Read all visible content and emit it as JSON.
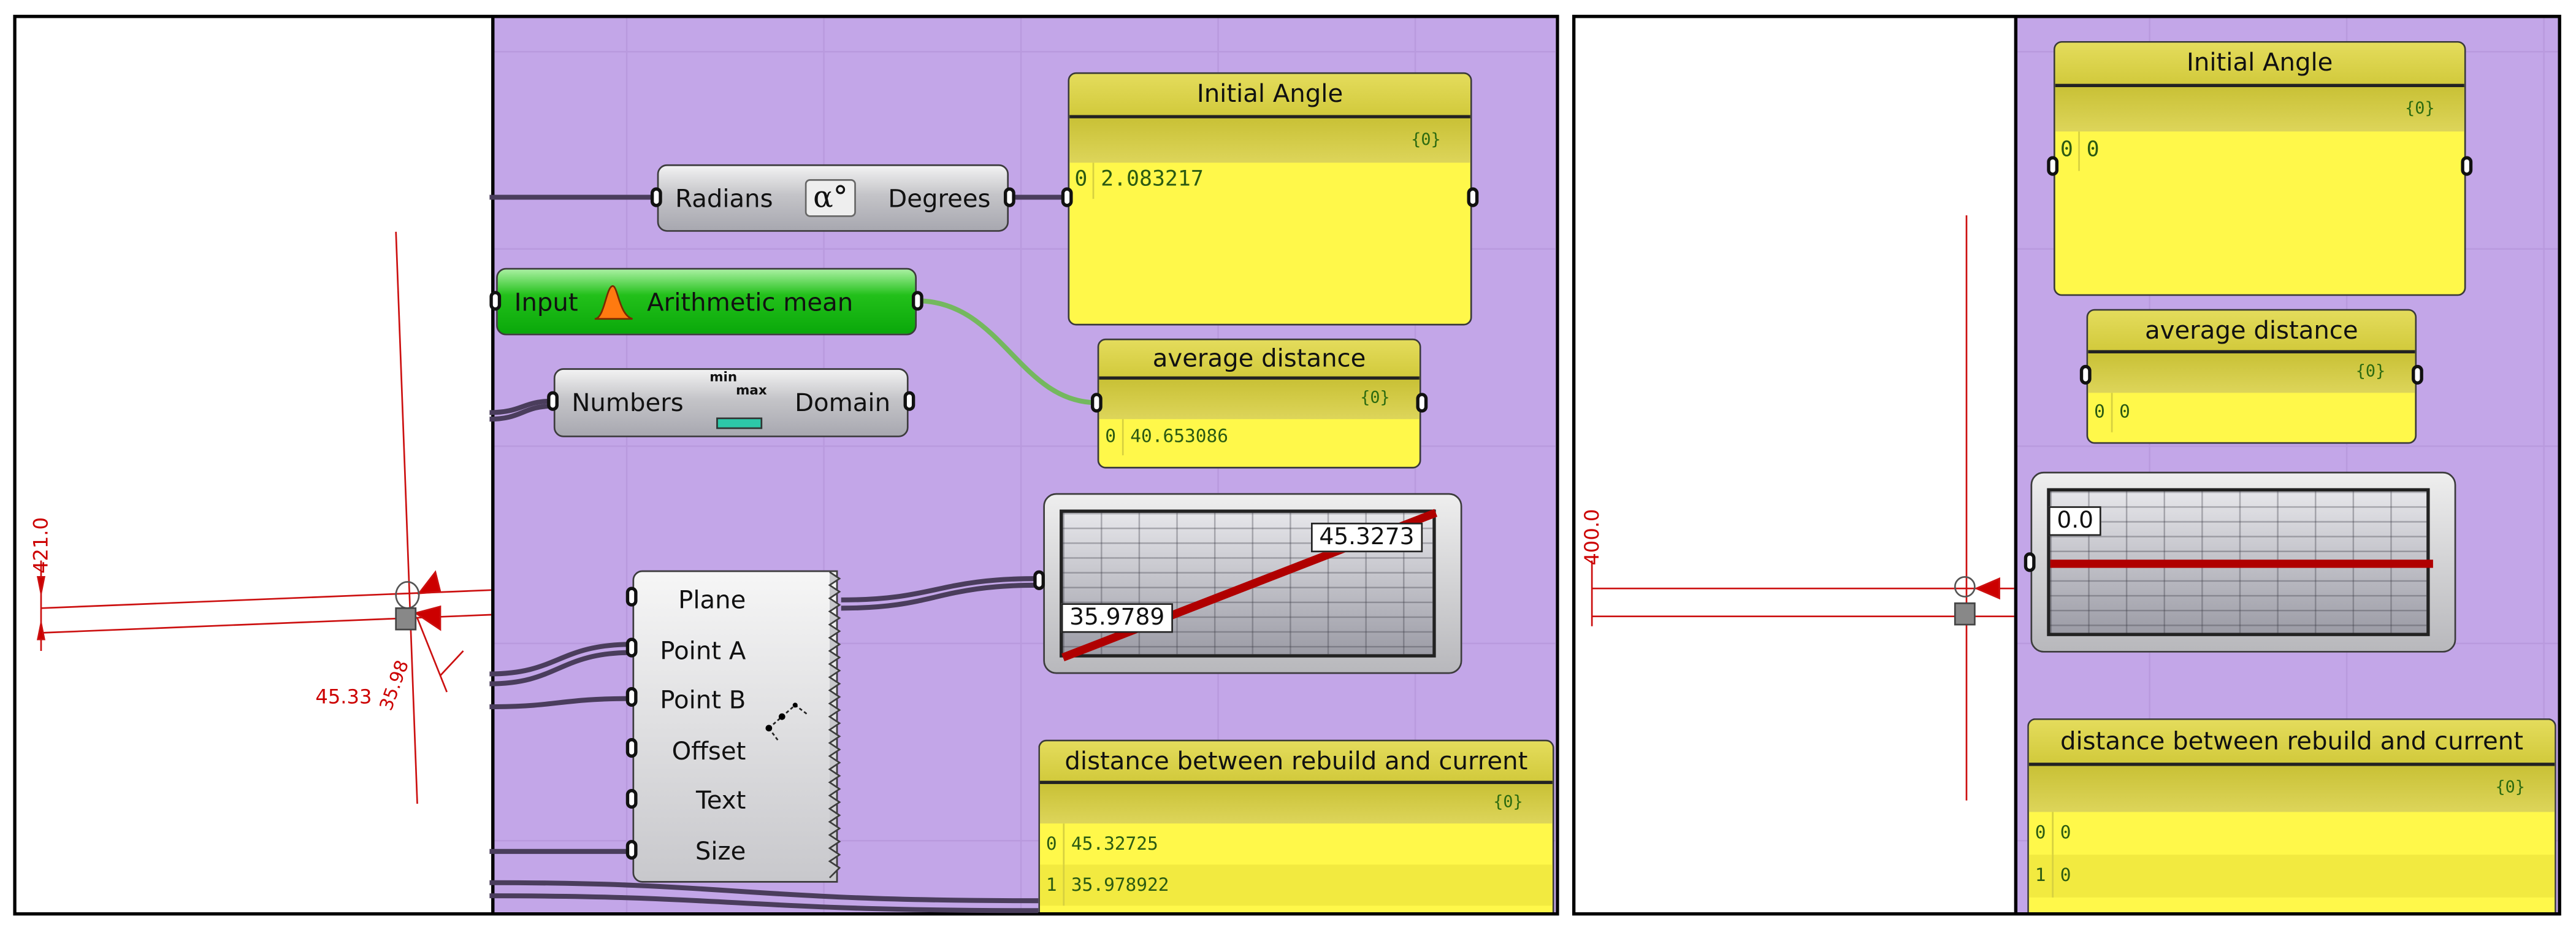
{
  "left_view": {
    "viewport": {
      "dimension_vertical": "421.0",
      "dimension_a": "45.33",
      "dimension_b": "35.98"
    },
    "components": {
      "radians_to_degrees": {
        "input": "Radians",
        "output": "Degrees",
        "icon": "alpha-degree-icon"
      },
      "average": {
        "input": "Input",
        "output": "Arithmetic mean",
        "icon": "bell-curve-icon"
      },
      "bounds": {
        "input": "Numbers",
        "output": "Domain",
        "icon": "min-max-domain-icon",
        "icon_min": "min",
        "icon_max": "max"
      },
      "aligned_dimension": {
        "inputs": [
          "Plane",
          "Point A",
          "Point B",
          "Offset",
          "Text",
          "Size"
        ],
        "icon": "dimension-icon"
      }
    },
    "initial_angle_panel": {
      "title": "Initial Angle",
      "path": "{0}",
      "rows": [
        {
          "index": "0",
          "value": "2.083217"
        }
      ]
    },
    "average_distance_panel": {
      "title": "average distance",
      "path": "{0}",
      "rows": [
        {
          "index": "0",
          "value": "40.653086"
        }
      ]
    },
    "graph_mapper": {
      "start_label": "35.9789",
      "end_label": "45.3273"
    },
    "distance_panel": {
      "title": "distance between rebuild and current",
      "path": "{0}",
      "rows": [
        {
          "index": "0",
          "value": "45.32725"
        },
        {
          "index": "1",
          "value": "35.978922"
        }
      ]
    }
  },
  "right_view": {
    "viewport": {
      "dimension_vertical": "400.0"
    },
    "initial_angle_panel": {
      "title": "Initial Angle",
      "path": "{0}",
      "rows": [
        {
          "index": "0",
          "value": "0"
        }
      ]
    },
    "average_distance_panel": {
      "title": "average distance",
      "path": "{0}",
      "rows": [
        {
          "index": "0",
          "value": "0"
        }
      ]
    },
    "graph_mapper": {
      "start_label": "0.0"
    },
    "distance_panel": {
      "title": "distance between rebuild and current",
      "path": "{0}",
      "rows": [
        {
          "index": "0",
          "value": "0"
        },
        {
          "index": "1",
          "value": "0"
        }
      ]
    }
  },
  "colors": {
    "canvas": "#c3a6e8",
    "panel": "#fff84a",
    "dimension_red": "#cc0000",
    "active_component": "#1eb81a"
  }
}
